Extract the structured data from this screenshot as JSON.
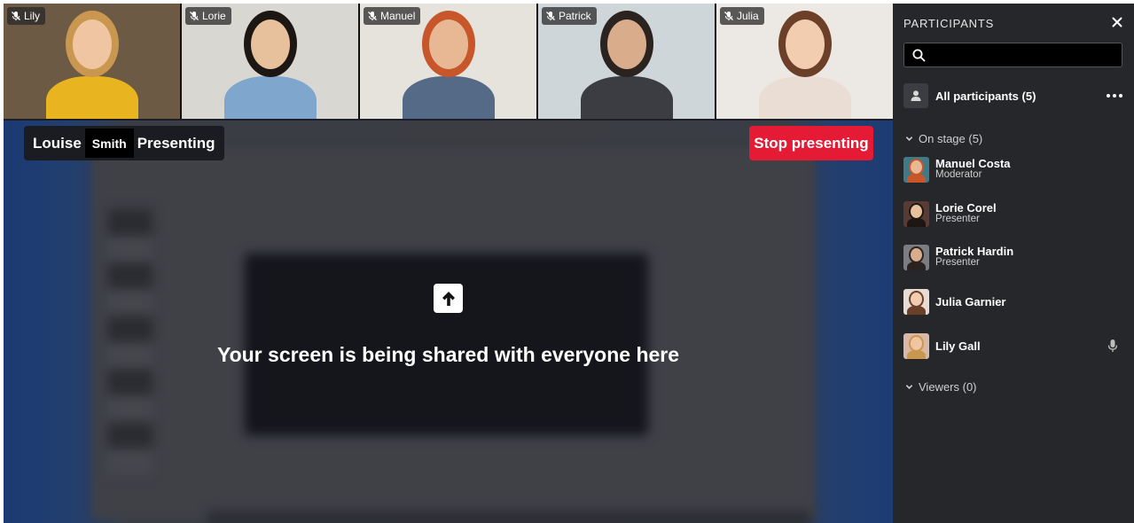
{
  "video_strip": [
    {
      "name": "Lily",
      "bg": "#6d5a44",
      "skin": "#f0c6a2",
      "hair": "#c9974f",
      "shirt": "#e8b520"
    },
    {
      "name": "Lorie",
      "bg": "#d9d7d2",
      "skin": "#e7c09c",
      "hair": "#1d1714",
      "shirt": "#7fa6cc"
    },
    {
      "name": "Manuel",
      "bg": "#e6e2dc",
      "skin": "#e8b793",
      "hair": "#c7562b",
      "shirt": "#556a86"
    },
    {
      "name": "Patrick",
      "bg": "#cfd6da",
      "skin": "#d9ad8c",
      "hair": "#2a2320",
      "shirt": "#3b3d42"
    },
    {
      "name": "Julia",
      "bg": "#ece8e3",
      "skin": "#f2cdb0",
      "hair": "#6b3f28",
      "shirt": "#e9ddd4"
    }
  ],
  "presenter": {
    "first": "Louise",
    "last": "Smith",
    "status": "Presenting"
  },
  "stop_button": "Stop presenting",
  "share_message": "Your screen is being shared with everyone here",
  "sidebar": {
    "title": "PARTICIPANTS",
    "search_placeholder": "",
    "all_participants": "All participants (5)",
    "on_stage": "On stage (5)",
    "viewers": "Viewers (0)",
    "participants": [
      {
        "name": "Manuel Costa",
        "role": "Moderator",
        "skin": "#e8b793",
        "hair": "#c7562b",
        "bg": "#3f7a86"
      },
      {
        "name": "Lorie Corel",
        "role": "Presenter",
        "skin": "#e7c09c",
        "hair": "#1d1714",
        "bg": "#5a3b34"
      },
      {
        "name": "Patrick Hardin",
        "role": "Presenter",
        "skin": "#d9ad8c",
        "hair": "#2a2320",
        "bg": "#7a7d82"
      },
      {
        "name": "Julia Garnier",
        "role": "",
        "skin": "#f2cdb0",
        "hair": "#6b3f28",
        "bg": "#e6dcd3"
      },
      {
        "name": "Lily Gall",
        "role": "",
        "skin": "#f0c6a2",
        "hair": "#c9974f",
        "bg": "#d9b9a5"
      }
    ]
  },
  "colors": {
    "stop": "#e51b35",
    "sidebar_bg": "#26272b"
  }
}
